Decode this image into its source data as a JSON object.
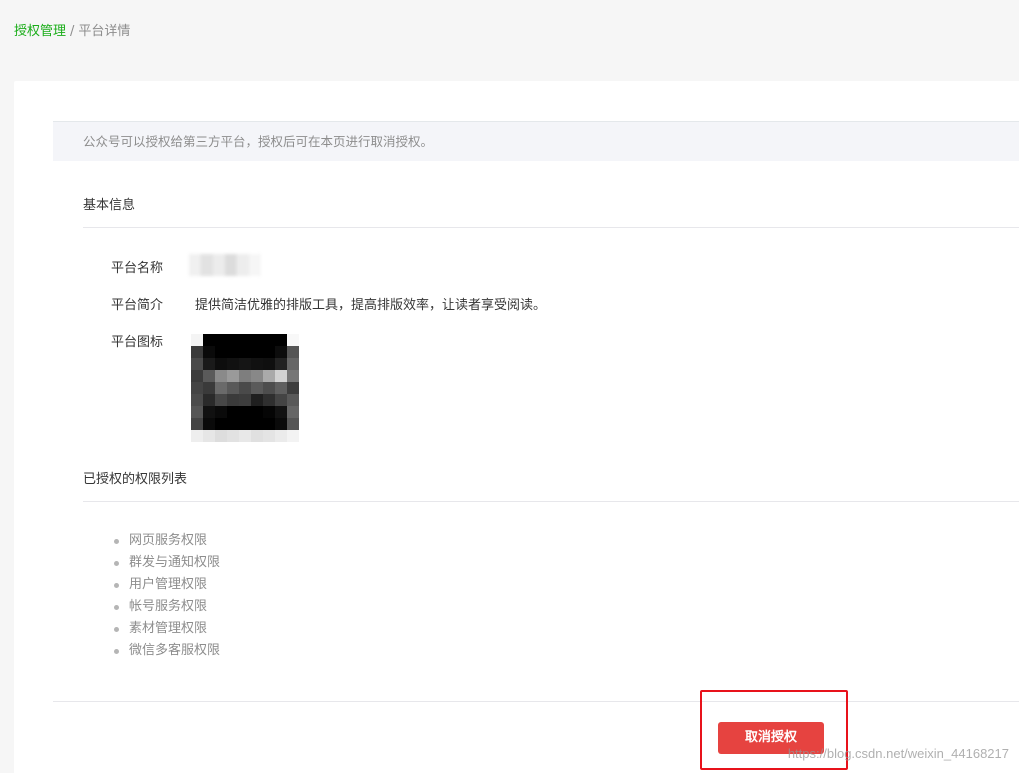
{
  "breadcrumb": {
    "parent": "授权管理",
    "separator": "/",
    "current": "平台详情"
  },
  "notice": {
    "text": "公众号可以授权给第三方平台，授权后可在本页进行取消授权。"
  },
  "basic_info": {
    "title": "基本信息",
    "name_label": "平台名称",
    "desc_label": "平台简介",
    "desc_value": "提供简洁优雅的排版工具，提高排版效率，让读者享受阅读。",
    "icon_label": "平台图标"
  },
  "permissions": {
    "title": "已授权的权限列表",
    "items": [
      "网页服务权限",
      "群发与通知权限",
      "用户管理权限",
      "帐号服务权限",
      "素材管理权限",
      "微信多客服权限"
    ]
  },
  "actions": {
    "cancel_label": "取消授权"
  },
  "watermark": {
    "text": "https://blog.csdn.net/weixin_44168217"
  },
  "colors": {
    "accent_green": "#1aad19",
    "danger_red": "#e64340",
    "highlight_red": "#e8121b"
  }
}
